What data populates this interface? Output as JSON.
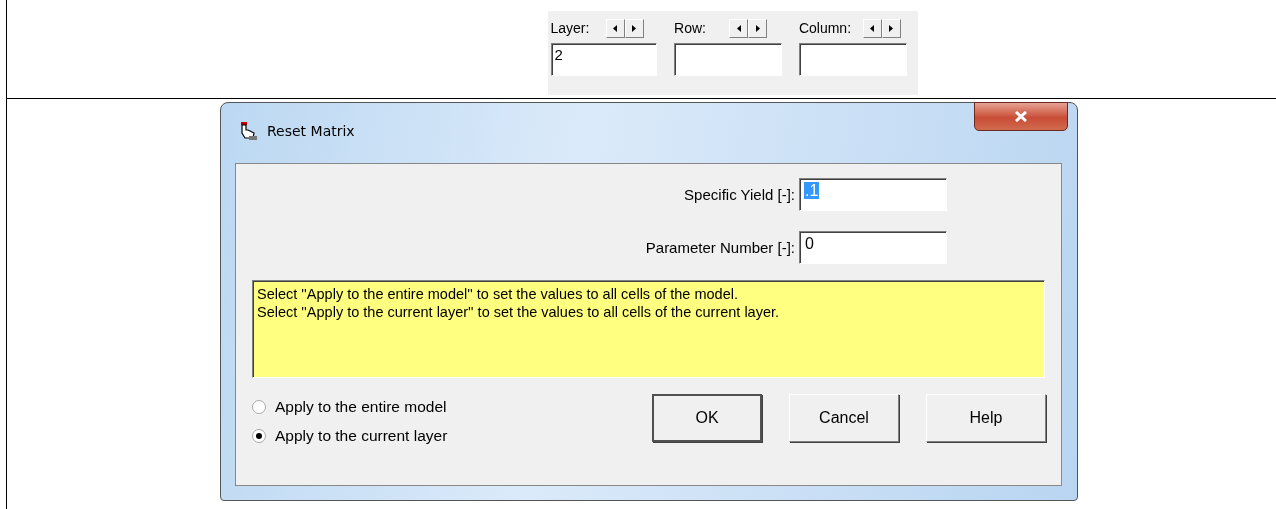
{
  "toolbar": {
    "spinners": [
      {
        "label": "Layer:",
        "value": "2"
      },
      {
        "label": "Row:"
      },
      {
        "label": "Column:"
      }
    ]
  },
  "dialog": {
    "title": "Reset Matrix",
    "fields": [
      {
        "label": "Specific Yield [-]:",
        "value": ".1",
        "text_selected": true
      },
      {
        "label": "Parameter Number [-]:",
        "value": "0",
        "text_selected": false
      }
    ],
    "info_lines": [
      "Select ''Apply to the entire model'' to set the values to all cells of the model.",
      "Select ''Apply to the current layer'' to set the values to all cells of the current layer."
    ],
    "options": [
      {
        "label": "Apply to the entire model",
        "selected": false
      },
      {
        "label": "Apply to the current layer",
        "selected": true
      }
    ],
    "buttons": [
      {
        "label": "OK",
        "default": true
      },
      {
        "label": "Cancel",
        "default": false
      },
      {
        "label": "Help",
        "default": false
      }
    ]
  }
}
